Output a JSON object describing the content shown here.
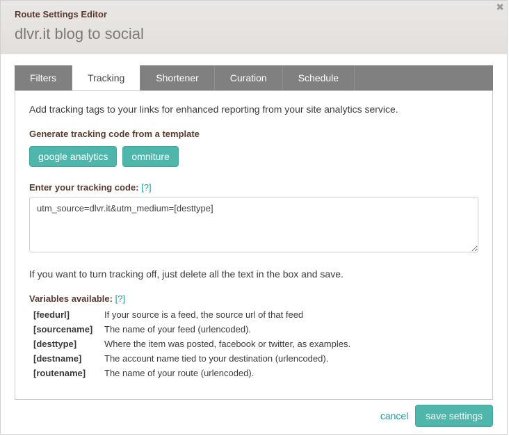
{
  "header": {
    "title": "Route Settings Editor",
    "subtitle": "dlvr.it blog to social"
  },
  "tabs": {
    "filters": "Filters",
    "tracking": "Tracking",
    "shortener": "Shortener",
    "curation": "Curation",
    "schedule": "Schedule"
  },
  "intro": "Add tracking tags to your links for enhanced reporting from your site analytics service.",
  "template": {
    "label": "Generate tracking code from a template",
    "ga": "google analytics",
    "omniture": "omniture"
  },
  "code": {
    "label": "Enter your tracking code:",
    "help": "[?]",
    "value": "utm_source=dlvr.it&utm_medium=[desttype]"
  },
  "off_note": "If you want to turn tracking off, just delete all the text in the box and save.",
  "vars": {
    "label": "Variables available:",
    "help": "[?]",
    "items": [
      {
        "name": "[feedurl]",
        "desc": "If your source is a feed, the source url of that feed"
      },
      {
        "name": "[sourcename]",
        "desc": "The name of your feed (urlencoded)."
      },
      {
        "name": "[desttype]",
        "desc": "Where the item was posted, facebook or twitter, as examples."
      },
      {
        "name": "[destname]",
        "desc": "The account name tied to your destination (urlencoded)."
      },
      {
        "name": "[routename]",
        "desc": "The name of your route (urlencoded)."
      }
    ]
  },
  "footer": {
    "cancel": "cancel",
    "save": "save settings"
  }
}
